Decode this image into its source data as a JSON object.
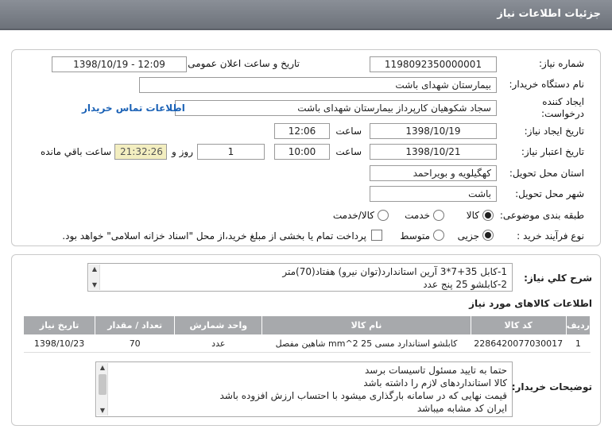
{
  "header": {
    "title": "جزئیات اطلاعات نیاز"
  },
  "form": {
    "need_number": {
      "label": "شماره نیاز:",
      "value": "1198092350000001"
    },
    "announce_datetime": {
      "label": "تاریخ و ساعت اعلان عمومی:",
      "value": "1398/10/19 - 12:09"
    },
    "buyer_org": {
      "label": "نام دستگاه خریدار:",
      "value": "بیمارستان شهدای باشت"
    },
    "creator": {
      "label_line1": "ایجاد کننده",
      "label_line2": "درخواست:",
      "value": "سجاد شکوهیان کارپرداز بیمارستان شهدای باشت",
      "contact_link": "اطلاعات تماس خریدار"
    },
    "created": {
      "label": "تاریخ ایجاد نیاز:",
      "date": "1398/10/19",
      "time_label": "ساعت",
      "time": "12:06"
    },
    "validity": {
      "label": "تاریخ اعتبار نیاز:",
      "date": "1398/10/21",
      "time_label": "ساعت",
      "time": "10:00",
      "days": "1",
      "days_label": "روز و",
      "remaining": "21:32:26",
      "remaining_label": "ساعت باقي مانده"
    },
    "province": {
      "label": "استان محل تحویل:",
      "value": "کهگیلویه و بویراحمد"
    },
    "city": {
      "label": "شهر محل تحویل:",
      "value": "باشت"
    },
    "category": {
      "label": "طبقه بندی موضوعی:",
      "options": [
        "کالا",
        "خدمت",
        "کالا/خدمت"
      ],
      "selected": "کالا"
    },
    "purchase": {
      "label": "نوع فرآیند خرید :",
      "options": [
        "جزیی",
        "متوسط"
      ],
      "selected": "جزیی",
      "note": "پرداخت تمام یا بخشی از مبلغ خرید،از محل \"اسناد خزانه اسلامی\" خواهد بود."
    }
  },
  "summary": {
    "label": "شرح کلي نياز:",
    "lines": [
      "1-کابل 35+7*3 آرین استاندارد(توان نیرو) هفتاد(70)متر",
      "2-کابلشو 25 پنج عدد"
    ]
  },
  "goods": {
    "title": "اطلاعات کالاهای مورد نیاز",
    "columns": [
      "ردیف",
      "کد کالا",
      "نام کالا",
      "واحد شمارش",
      "تعداد / مقدار",
      "تاریخ نیاز"
    ],
    "rows": [
      [
        "1",
        "2286420077030017",
        "کابلشو استاندارد مسی 25 mm^2 شاهین مفصل",
        "عدد",
        "70",
        "1398/10/23"
      ]
    ]
  },
  "buyer_notes": {
    "label": "توضیحات خریدار:",
    "lines": [
      "حتما به تایید مسئول تاسیسات برسد",
      "کالا استانداردهای لازم را داشته باشد",
      "قیمت نهایی که در سامانه بارگذاری میشود با احتساب ارزش افزوده باشد",
      "ایران کد مشابه میباشد"
    ]
  }
}
